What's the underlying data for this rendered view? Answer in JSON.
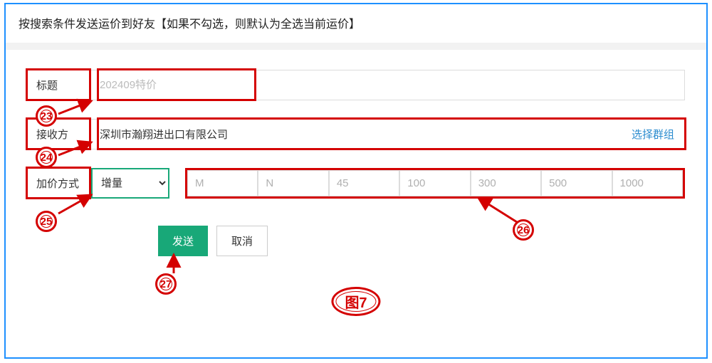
{
  "header": "按搜索条件发送运价到好友【如果不勾选，则默认为全选当前运价】",
  "form": {
    "title_label": "标题",
    "title_placeholder": "202409特价",
    "receiver_label": "接收方",
    "receiver_value": "深圳市瀚翔进出口有限公司",
    "select_group_link": "选择群组",
    "markup_label": "加价方式",
    "markup_option": "增量",
    "tiers": [
      "M",
      "N",
      "45",
      "100",
      "300",
      "500",
      "1000"
    ]
  },
  "buttons": {
    "send": "发送",
    "cancel": "取消"
  },
  "annotations": {
    "n23": "23",
    "n24": "24",
    "n25": "25",
    "n26": "26",
    "n27": "27",
    "caption": "图7"
  }
}
